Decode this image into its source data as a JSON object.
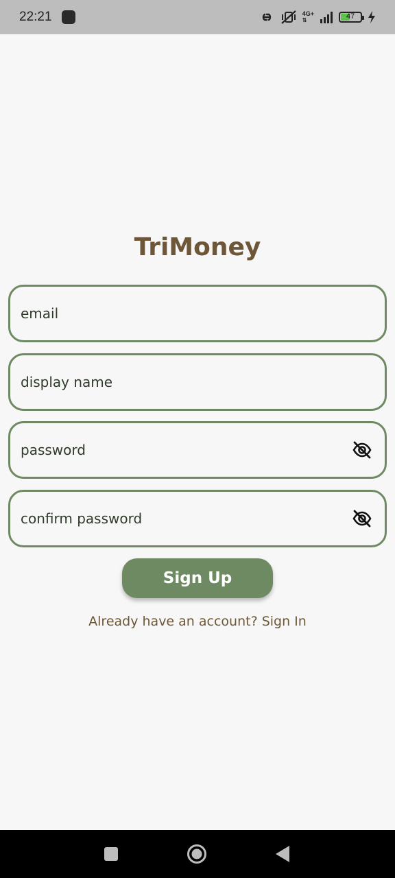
{
  "status_bar": {
    "time": "22:21",
    "network": "4G+",
    "battery": "47",
    "battery_level": 0.47,
    "icons": [
      "notification-icon",
      "link-icon",
      "mute-vibrate-icon",
      "signal-icon",
      "battery-icon",
      "charging-icon"
    ]
  },
  "app": {
    "title": "TriMoney"
  },
  "form": {
    "email_placeholder": "email",
    "display_name_placeholder": "display name",
    "password_placeholder": "password",
    "confirm_password_placeholder": "confirm password",
    "submit_label": "Sign Up",
    "signin_prompt": "Already have an account? Sign In"
  },
  "nav_bar": {
    "icons": [
      "recents-icon",
      "home-icon",
      "back-icon"
    ]
  },
  "colors": {
    "accent": "#6e8a62",
    "brand_text": "#6d5738",
    "background": "#f7f7f7"
  }
}
